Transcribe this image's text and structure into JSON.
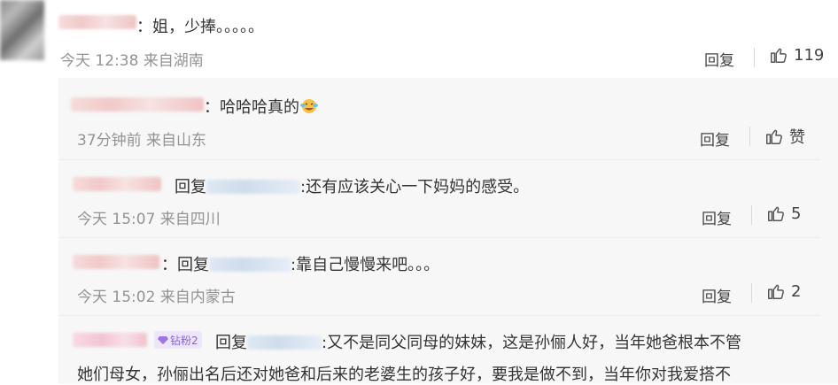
{
  "comment": {
    "text": "：姐，少捧。。。。。",
    "time": "今天 12:38 来自湖南",
    "reply_label": "回复",
    "likes": "119"
  },
  "replies": [
    {
      "text": "：哈哈哈真的",
      "time": "37分钟前 来自山东",
      "reply_label": "回复",
      "likes": "赞"
    },
    {
      "reply_word": "回复",
      "text": ":还有应该关心一下妈妈的感受。",
      "time": "今天 15:07 来自四川",
      "reply_label": "回复",
      "likes": "5"
    },
    {
      "prefix": "：",
      "reply_word": "回复",
      "text": ":靠自己慢慢来吧。。。",
      "time": "今天 15:02 来自内蒙古",
      "reply_label": "回复",
      "likes": "2"
    },
    {
      "badge": "钻粉2",
      "reply_word": "回复",
      "text_line1": ":又不是同父同母的妹妹，这是孙俪人好，当年她爸根本不管",
      "text_line2": "她们母女，孙俪出名后还对她爸和后来的老婆生的孩子好，要我是做不到，当年你对我爱搭不"
    }
  ],
  "colors": {
    "panel_bg": "#f7f7f7",
    "meta_text": "#939393",
    "badge_bg": "#ede6fb",
    "badge_text": "#8a63d8"
  }
}
